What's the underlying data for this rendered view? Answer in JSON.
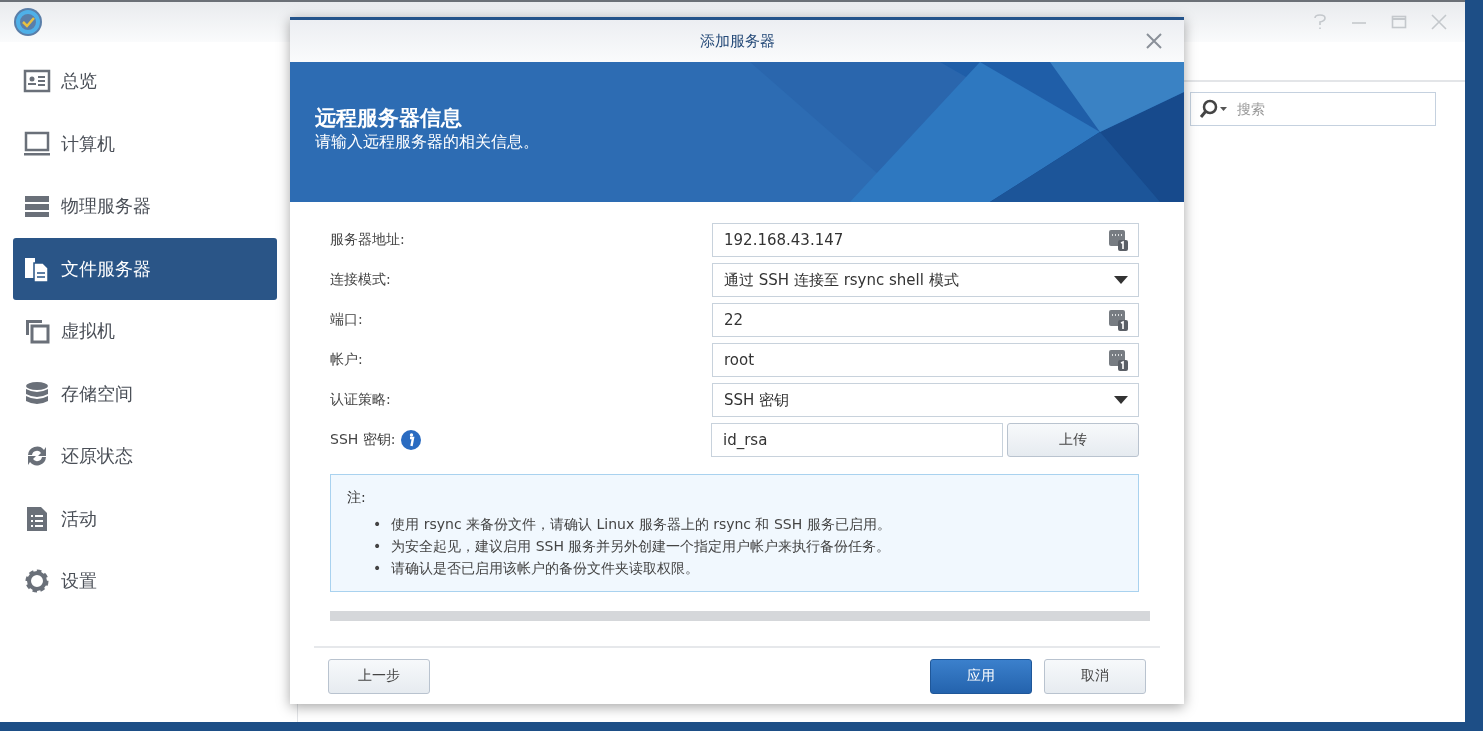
{
  "sidebar": {
    "items": [
      {
        "label": "总览",
        "selected": false
      },
      {
        "label": "计算机",
        "selected": false
      },
      {
        "label": "物理服务器",
        "selected": false
      },
      {
        "label": "文件服务器",
        "selected": true
      },
      {
        "label": "虚拟机",
        "selected": false
      },
      {
        "label": "存储空间",
        "selected": false
      },
      {
        "label": "还原状态",
        "selected": false
      },
      {
        "label": "活动",
        "selected": false
      },
      {
        "label": "设置",
        "selected": false
      }
    ]
  },
  "search": {
    "placeholder": "搜索"
  },
  "dialog": {
    "title": "添加服务器",
    "heading": "远程服务器信息",
    "subheading": "请输入远程服务器的相关信息。",
    "fields": [
      {
        "label": "服务器地址:",
        "kind": "text",
        "value": "192.168.43.147"
      },
      {
        "label": "连接模式:",
        "kind": "select",
        "value": "通过 SSH 连接至 rsync shell 模式"
      },
      {
        "label": "端口:",
        "kind": "text",
        "value": "22"
      },
      {
        "label": "帐户:",
        "kind": "text",
        "value": "root"
      },
      {
        "label": "认证策略:",
        "kind": "select",
        "value": "SSH 密钥"
      },
      {
        "label": "SSH 密钥:",
        "kind": "file",
        "value": "id_rsa",
        "button": "上传"
      }
    ],
    "note": {
      "title": "注:",
      "items": [
        {
          "bullet": "•",
          "text": "使用 rsync 来备份文件，请确认 Linux 服务器上的 rsync 和 SSH 服务已启用。"
        },
        {
          "bullet": "•",
          "text": "为安全起见，建议启用 SSH 服务并另外创建一个指定用户帐户来执行备份任务。"
        },
        {
          "bullet": "•",
          "text": "请确认是否已启用该帐户的备份文件夹读取权限。"
        }
      ]
    },
    "buttons": {
      "back": "上一步",
      "apply": "应用",
      "cancel": "取消"
    }
  }
}
